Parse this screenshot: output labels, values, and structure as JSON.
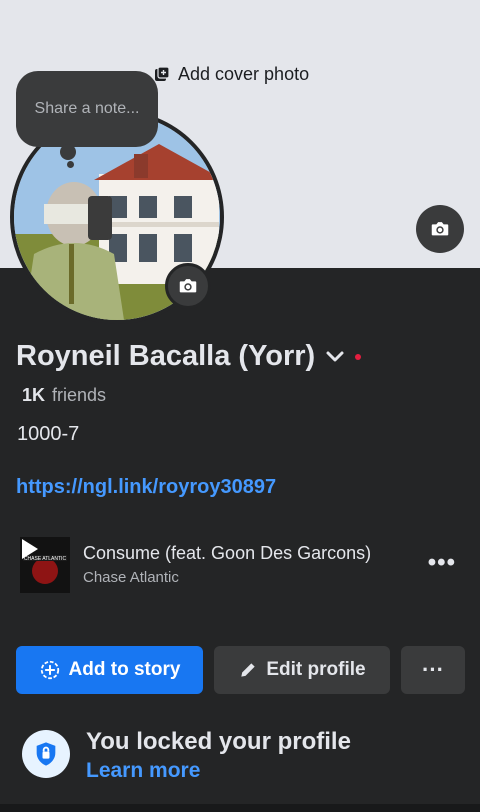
{
  "cover": {
    "add_cover_label": "Add cover photo"
  },
  "note": {
    "placeholder": "Share a note..."
  },
  "profile": {
    "name": "Royneil Bacalla (Yorr)",
    "friends_count": "1K",
    "friends_label": "friends",
    "bio": "1000-7",
    "link": "https://ngl.link/royroy30897"
  },
  "music": {
    "song": "Consume (feat. Goon Des Garcons)",
    "artist": "Chase Atlantic",
    "album_text": "CHASE ATLANTIC"
  },
  "actions": {
    "add_to_story": "Add to story",
    "edit_profile": "Edit profile",
    "more": "···"
  },
  "locked": {
    "title": "You locked your profile",
    "learn_more": "Learn more"
  },
  "colors": {
    "accent": "#1877f2",
    "link": "#4599ff",
    "background": "#242526",
    "cover": "#e4e6eb",
    "status_dot": "#e41e3f"
  },
  "icons": [
    "add-photo-icon",
    "camera-icon",
    "chevron-down-icon",
    "play-icon",
    "more-icon",
    "add-story-icon",
    "pencil-icon",
    "shield-lock-icon"
  ]
}
